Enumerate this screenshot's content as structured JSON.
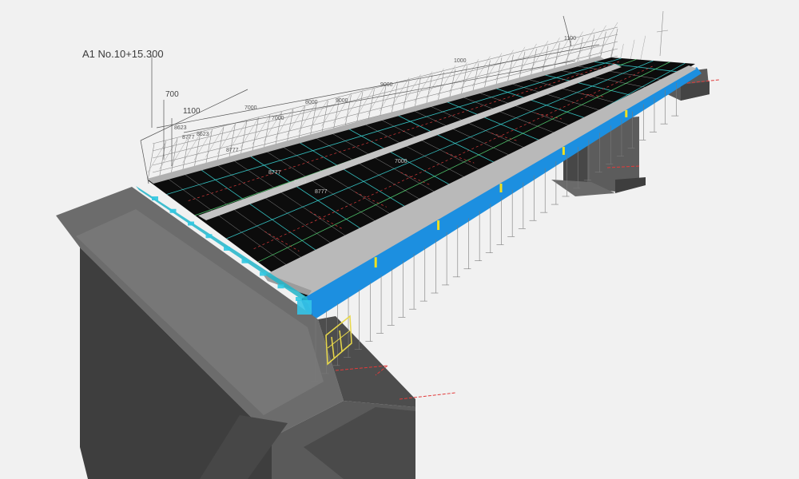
{
  "viewer": {
    "station_label": "A1 No.10+15.300"
  },
  "dimensions": {
    "left_vertical": [
      "700",
      "1100"
    ],
    "stack": [
      "8623",
      "8777",
      "8623",
      "8777"
    ],
    "top_run": [
      "7000",
      "7000",
      "8000",
      "9000",
      "1000",
      "9000"
    ],
    "deck": [
      "8777",
      "8623",
      "8777",
      "7000"
    ],
    "far_tag": "1100"
  },
  "colors": {
    "girder": "#1c8fe0",
    "deck": "#0c0c0c",
    "barrier": "#b9b9b9",
    "abutment_top": "#6a6a6a",
    "abutment_side": "#3f3f3f",
    "pier": "#5a5a5a",
    "grid_cyan": "#38d4d4",
    "grid_green": "#59e07a",
    "axis_red": "#e23a3a",
    "marker_yellow": "#f0e020",
    "background": "#f1f1f1"
  },
  "icons": {
    "compass": "coordinate-axis-icon",
    "marker": "section-marker-icon"
  }
}
